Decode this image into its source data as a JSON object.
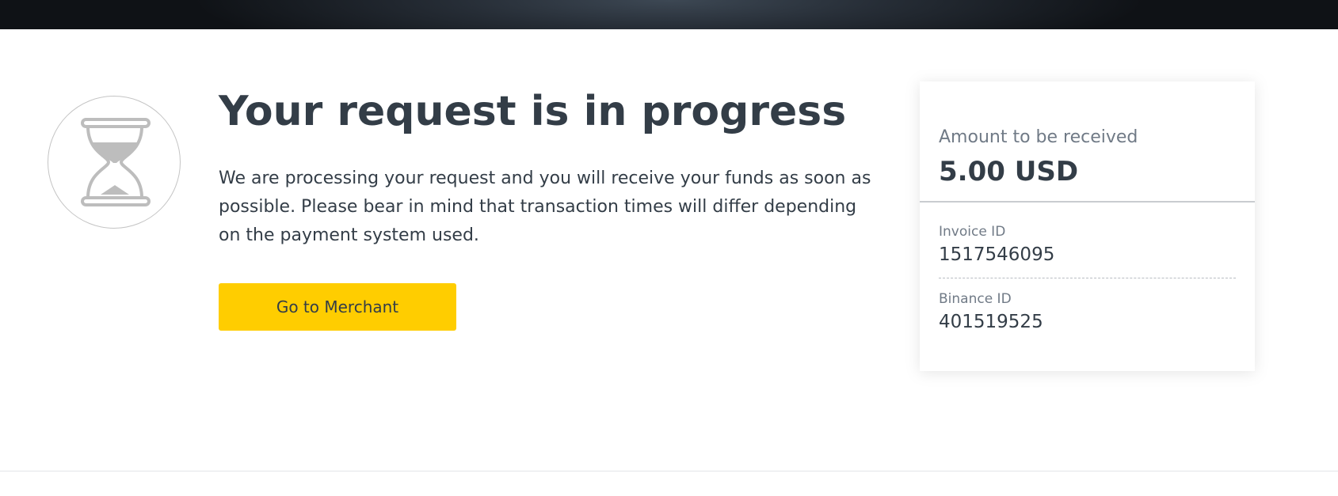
{
  "header": {
    "bar_color": "#1b2028"
  },
  "status": {
    "icon": "hourglass-icon",
    "title": "Your request is in progress",
    "description": "We are processing your request and you will receive your funds as soon as possible. Please bear in mind that transaction times will differ depending on the payment system used."
  },
  "actions": {
    "merchant_button_label": "Go to Merchant",
    "accent_color": "#ffcd00"
  },
  "receipt": {
    "amount_label": "Amount to be received",
    "amount_value": "5.00 USD",
    "fields": [
      {
        "label": "Invoice ID",
        "value": "1517546095"
      },
      {
        "label": "Binance ID",
        "value": "401519525"
      }
    ]
  }
}
